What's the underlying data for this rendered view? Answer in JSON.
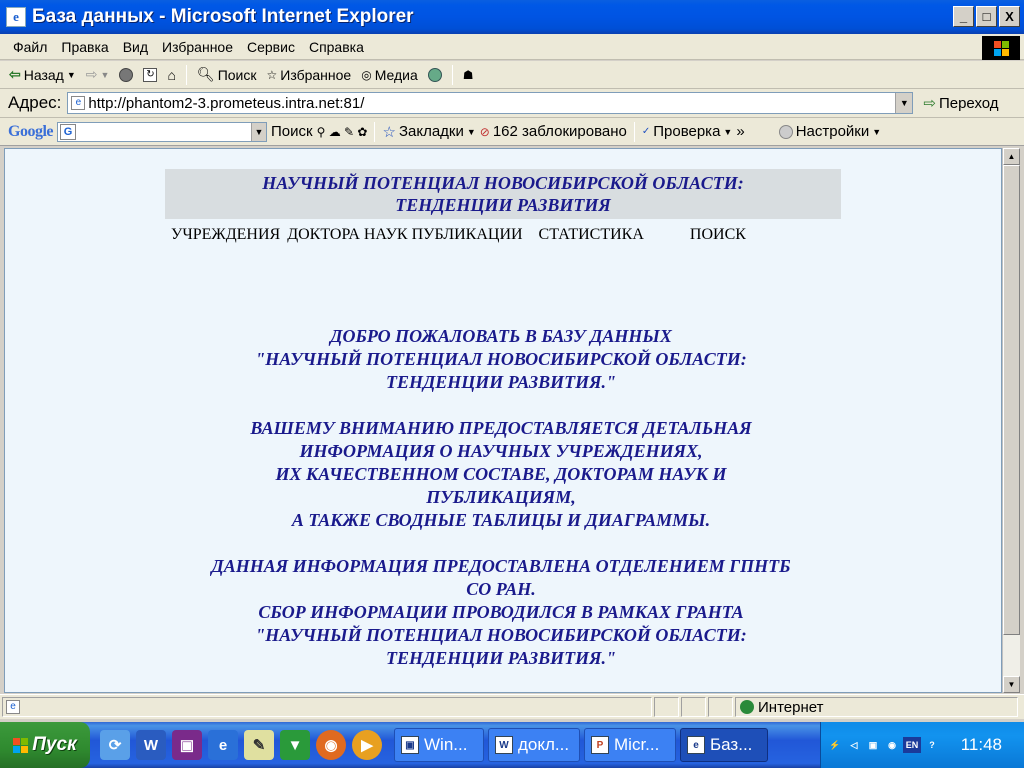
{
  "window": {
    "title": "База данных - Microsoft Internet Explorer",
    "minimize": "_",
    "maximize": "□",
    "close": "X"
  },
  "menu": [
    "Файл",
    "Правка",
    "Вид",
    "Избранное",
    "Сервис",
    "Справка"
  ],
  "toolbar": {
    "back": "Назад",
    "search": "Поиск",
    "favorites": "Избранное",
    "media": "Медиа"
  },
  "address": {
    "label": "Адрес:",
    "url": "http://phantom2-3.prometeus.intra.net:81/",
    "go": "Переход"
  },
  "googlebar": {
    "logo": "Google",
    "search_button": "Поиск",
    "bookmarks": "Закладки",
    "blocked": "162 заблокировано",
    "spellcheck": "Проверка",
    "settings": "Настройки"
  },
  "page": {
    "header_line1": "НАУЧНЫЙ ПОТЕНЦИАЛ НОВОСИБИРСКОЙ ОБЛАСТИ:",
    "header_line2": "ТЕНДЕНЦИИ РАЗВИТИЯ",
    "nav": {
      "institutions": "УЧРЕЖДЕНИЯ",
      "doctors": "ДОКТОРА НАУК",
      "publications": "ПУБЛИКАЦИИ",
      "statistics": "СТАТИСТИКА",
      "search": "ПОИСК"
    },
    "welcome": [
      "ДОБРО ПОЖАЛОВАТЬ В БАЗУ ДАННЫХ",
      "\"НАУЧНЫЙ ПОТЕНЦИАЛ НОВОСИБИРСКОЙ ОБЛАСТИ:",
      "ТЕНДЕНЦИИ РАЗВИТИЯ.\""
    ],
    "info": [
      "ВАШЕМУ ВНИМАНИЮ ПРЕДОСТАВЛЯЕТСЯ ДЕТАЛЬНАЯ",
      "ИНФОРМАЦИЯ О НАУЧНЫХ УЧРЕЖДЕНИЯХ,",
      "ИХ КАЧЕСТВЕННОМ СОСТАВЕ, ДОКТОРАМ НАУК И",
      "ПУБЛИКАЦИЯМ,",
      "А ТАКЖЕ СВОДНЫЕ ТАБЛИЦЫ И ДИАГРАММЫ."
    ],
    "source": [
      "ДАННАЯ ИНФОРМАЦИЯ ПРЕДОСТАВЛЕНА ОТДЕЛЕНИЕМ ГПНТБ",
      "СО РАН.",
      "СБОР ИНФОРМАЦИИ ПРОВОДИЛСЯ В РАМКАХ ГРАНТА",
      "\"НАУЧНЫЙ ПОТЕНЦИАЛ НОВОСИБИРСКОЙ ОБЛАСТИ:",
      "ТЕНДЕНЦИИ РАЗВИТИЯ.\""
    ]
  },
  "status": {
    "zone": "Интернет"
  },
  "taskbar": {
    "start": "Пуск",
    "tasks": [
      "Win...",
      "докл...",
      "Micr...",
      "Баз..."
    ],
    "clock": "11:48"
  }
}
